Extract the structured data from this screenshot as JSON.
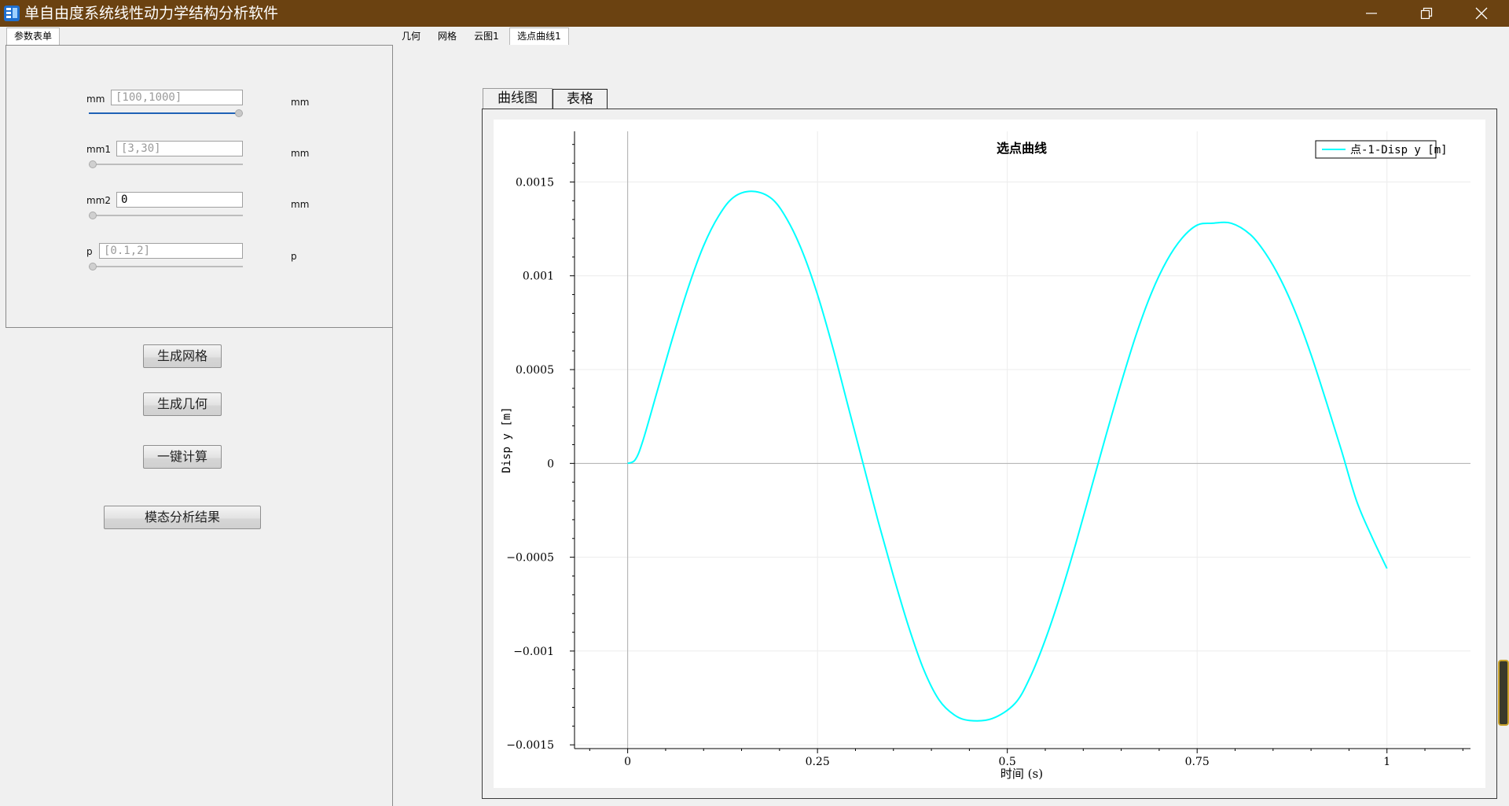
{
  "window": {
    "title": "单自由度系统线性动力学结构分析软件"
  },
  "left_tabs": [
    {
      "label": "参数表单"
    }
  ],
  "main_tabs": [
    {
      "label": "几何"
    },
    {
      "label": "网格"
    },
    {
      "label": "云图1"
    },
    {
      "label": "选点曲线1"
    }
  ],
  "params": [
    {
      "label": "mm",
      "value": "",
      "placeholder": "[100,1000]",
      "unit": "mm",
      "slider_fraction": 1.0
    },
    {
      "label": "mm1",
      "value": "",
      "placeholder": "[3,30]",
      "unit": "mm",
      "slider_fraction": 0.0
    },
    {
      "label": "mm2",
      "value": "0",
      "placeholder": "",
      "unit": "mm",
      "slider_fraction": 0.0
    },
    {
      "label": "p",
      "value": "",
      "placeholder": "[0.1,2]",
      "unit": "p",
      "slider_fraction": 0.0
    }
  ],
  "buttons": {
    "gen_mesh": "生成网格",
    "gen_geometry": "生成几何",
    "one_click_compute": "一键计算",
    "modal_results": "模态分析结果"
  },
  "result_tabs": [
    {
      "label": "曲线图"
    },
    {
      "label": "表格"
    }
  ],
  "colors": {
    "titlebar": "#6b4211",
    "curve": "#00ffff",
    "slider_fill": "#1f62b6"
  },
  "chart_data": {
    "type": "line",
    "title": "选点曲线",
    "xlabel": "时间 (s)",
    "ylabel": "Disp y [m]",
    "xlim": [
      -0.07,
      1.11
    ],
    "ylim": [
      -0.00152,
      0.00177
    ],
    "x_ticks": [
      0,
      0.25,
      0.5,
      0.75,
      1
    ],
    "x_tick_labels": [
      "0",
      "0.25",
      "0.5",
      "0.75",
      "1"
    ],
    "y_ticks": [
      0.0015,
      0.001,
      0.0005,
      0,
      -0.0005,
      -0.001,
      -0.0015
    ],
    "y_tick_labels": [
      "0.0015",
      "0.001",
      "0.0005",
      "0",
      "−0.0005",
      "−0.001",
      "−0.0015"
    ],
    "grid": true,
    "legend": "top-right",
    "series": [
      {
        "name": "点-1-Disp y [m]",
        "x": [
          0,
          0.01,
          0.02,
          0.04,
          0.06,
          0.08,
          0.1,
          0.12,
          0.14,
          0.165,
          0.19,
          0.21,
          0.23,
          0.25,
          0.27,
          0.29,
          0.31,
          0.33,
          0.35,
          0.37,
          0.39,
          0.41,
          0.43,
          0.45,
          0.48,
          0.51,
          0.53,
          0.55,
          0.57,
          0.59,
          0.61,
          0.63,
          0.65,
          0.67,
          0.69,
          0.71,
          0.73,
          0.75,
          0.77,
          0.795,
          0.82,
          0.84,
          0.86,
          0.88,
          0.9,
          0.92,
          0.94,
          0.96,
          0.98,
          1.0
        ],
        "y": [
          0,
          2e-05,
          0.00012,
          0.0004,
          0.00068,
          0.00094,
          0.00116,
          0.00132,
          0.00142,
          0.00145,
          0.00141,
          0.0013,
          0.00113,
          0.0009,
          0.00062,
          0.00031,
          0.0,
          -0.00031,
          -0.0006,
          -0.00087,
          -0.0011,
          -0.00126,
          -0.00134,
          -0.00137,
          -0.00136,
          -0.00128,
          -0.00114,
          -0.00094,
          -0.0007,
          -0.00043,
          -0.00014,
          0.00015,
          0.00043,
          0.00069,
          0.00091,
          0.00108,
          0.0012,
          0.00127,
          0.00128,
          0.00128,
          0.00122,
          0.00112,
          0.00098,
          0.0008,
          0.00058,
          0.00033,
          7e-05,
          -0.0002,
          -0.00039,
          -0.00056
        ]
      }
    ]
  }
}
